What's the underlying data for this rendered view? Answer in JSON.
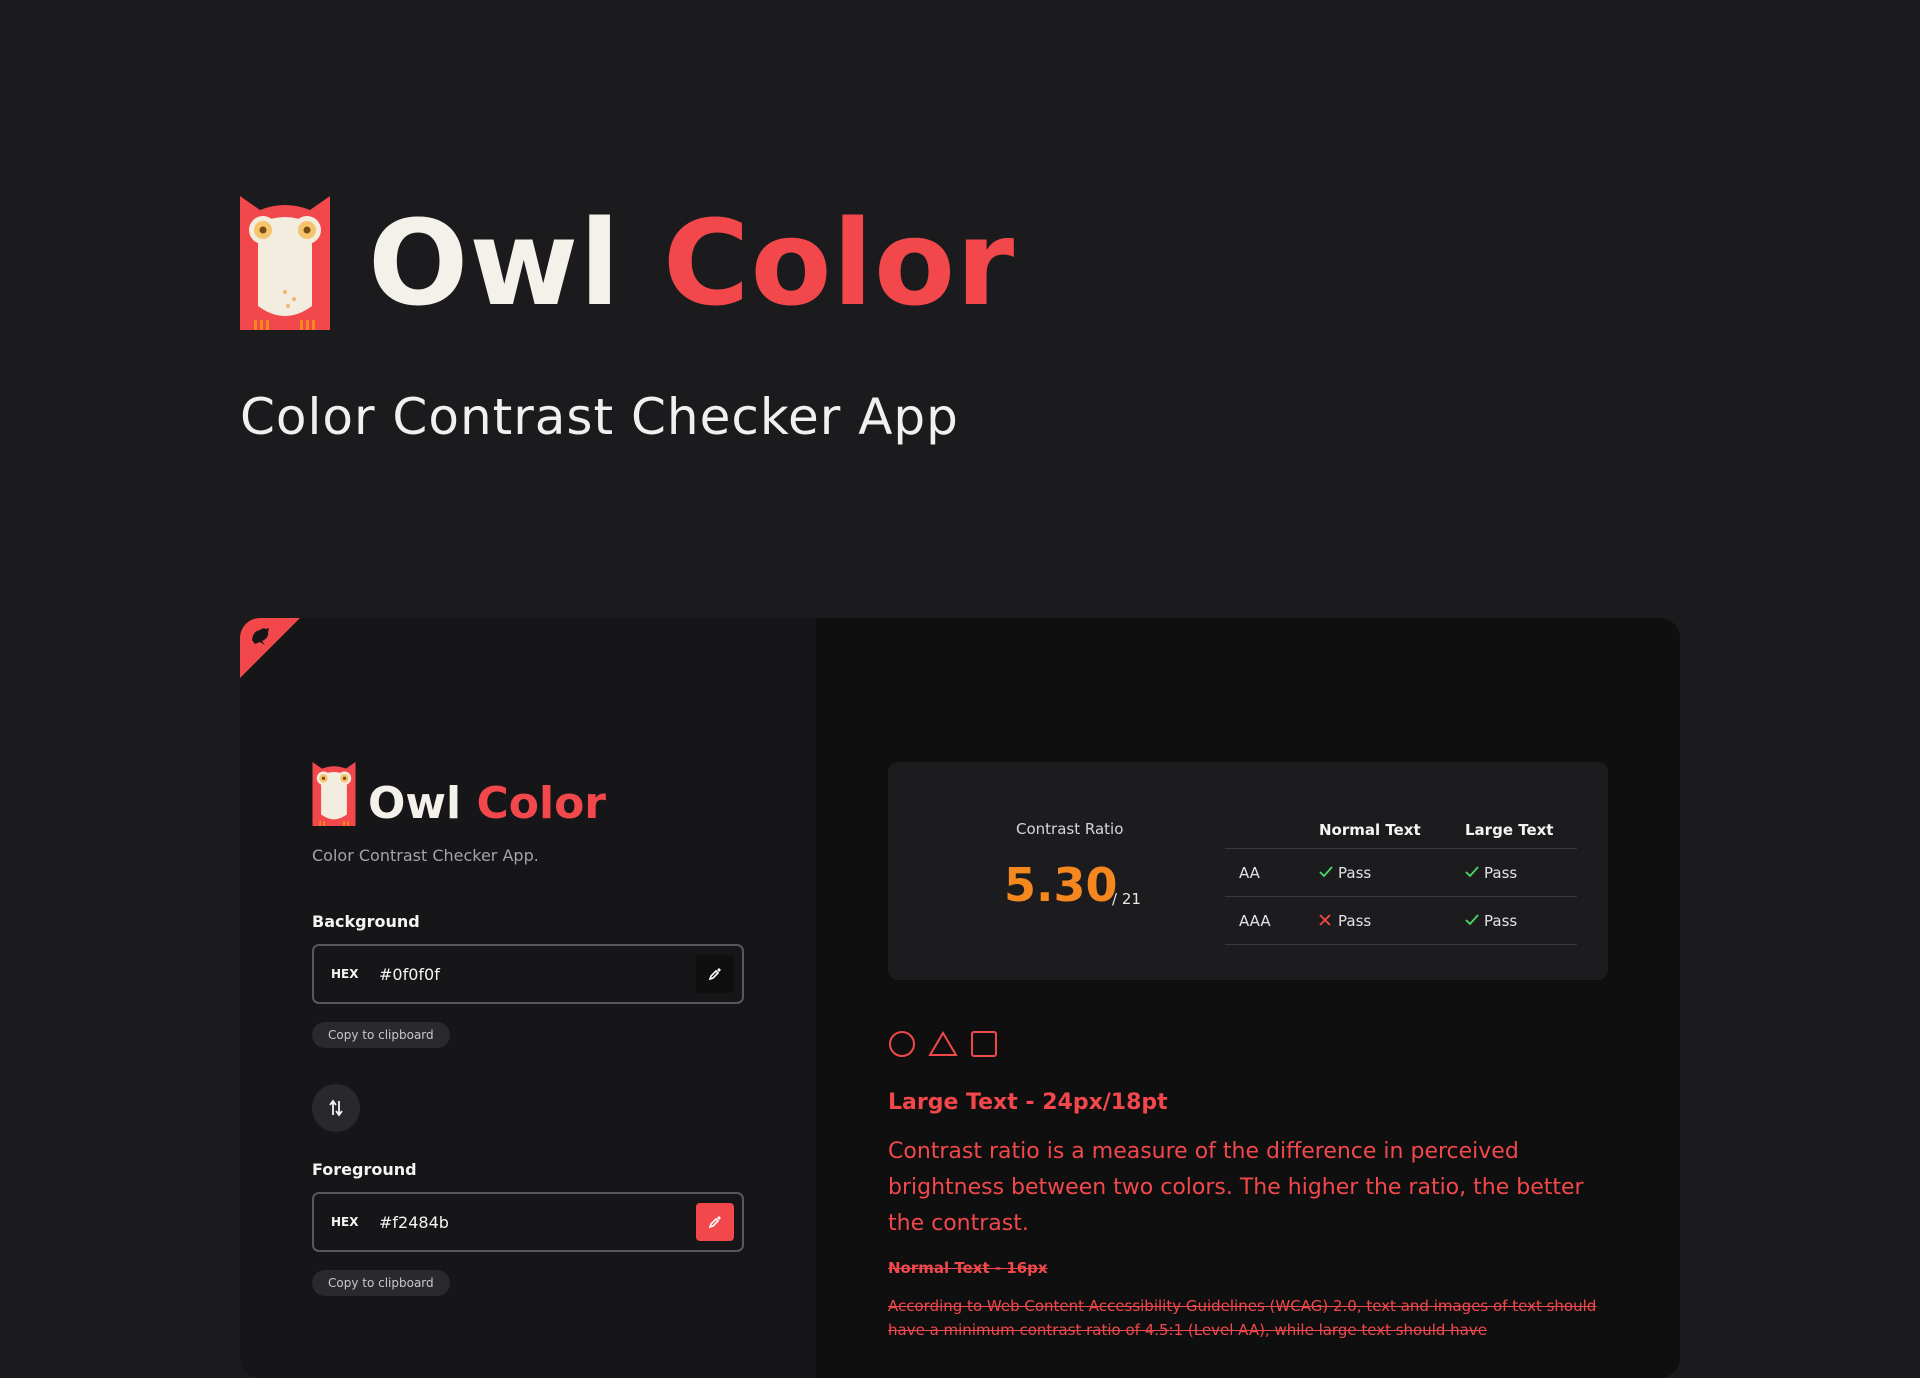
{
  "hero": {
    "title_word1": "Owl",
    "title_word2": "Color",
    "subtitle": "Color Contrast Checker App"
  },
  "app": {
    "brand": {
      "word1": "Owl",
      "word2": "Color",
      "tagline": "Color Contrast Checker App."
    },
    "background": {
      "label": "Background",
      "format": "HEX",
      "value": "#0f0f0f",
      "copy_label": "Copy to clipboard"
    },
    "foreground": {
      "label": "Foreground",
      "format": "HEX",
      "value": "#f2484b",
      "copy_label": "Copy to clipboard"
    },
    "swap_icon": "swap-arrows-icon"
  },
  "results": {
    "ratio_label": "Contrast Ratio",
    "ratio_value": "5.30",
    "ratio_max": "/ 21",
    "columns": [
      "Normal Text",
      "Large Text"
    ],
    "rows": [
      {
        "level": "AA",
        "normal": {
          "status": "pass",
          "label": "Pass"
        },
        "large": {
          "status": "pass",
          "label": "Pass"
        }
      },
      {
        "level": "AAA",
        "normal": {
          "status": "fail",
          "label": "Pass"
        },
        "large": {
          "status": "pass",
          "label": "Pass"
        }
      }
    ]
  },
  "preview": {
    "shapes": [
      "circle-icon",
      "triangle-icon",
      "square-icon"
    ],
    "large_title": "Large Text - 24px/18pt",
    "large_body": "Contrast ratio is a measure of the difference in perceived brightness between two colors. The higher the ratio, the better the contrast.",
    "normal_title": "Normal Text - 16px",
    "normal_body": "According to Web Content Accessibility Guidelines (WCAG) 2.0, text and images of text should have a minimum contrast ratio of 4.5:1 (Level AA), while large text should have"
  },
  "colors": {
    "page_bg": "#1b1b1d",
    "accent": "#f2484b",
    "ratio": "#f5871f",
    "pass": "#4bd866",
    "left_panel": "#161619",
    "right_panel": "#0f0f0f"
  }
}
